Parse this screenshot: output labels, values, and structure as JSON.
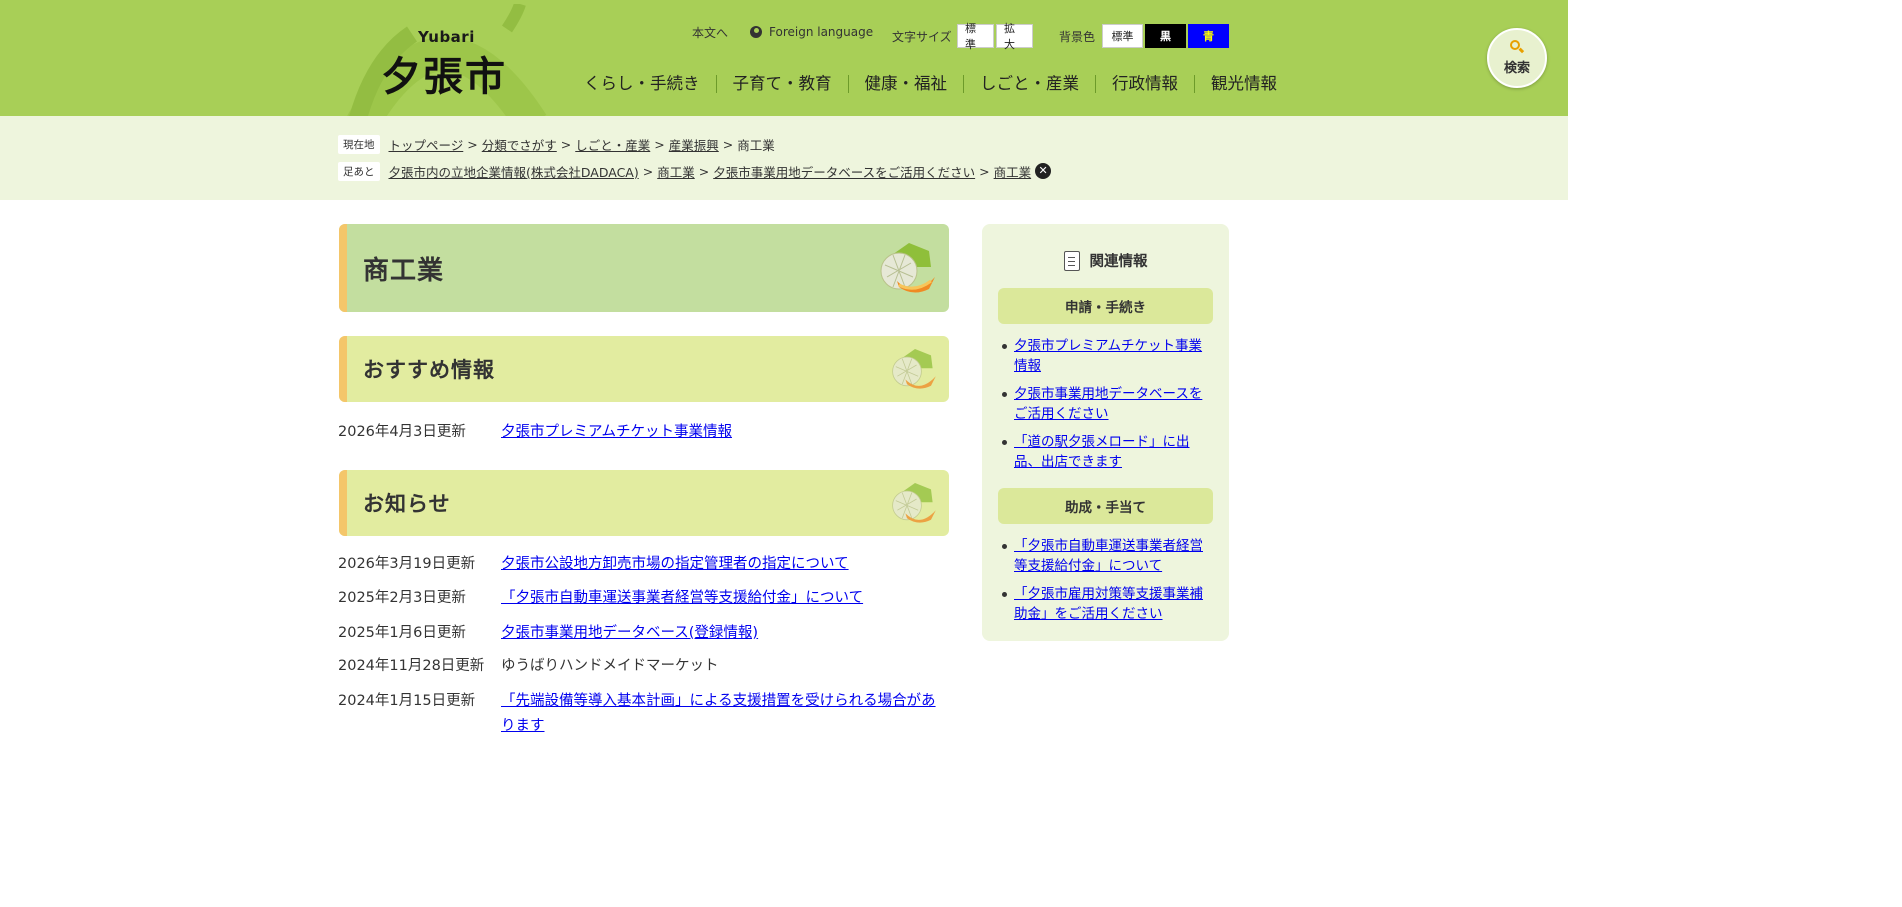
{
  "header": {
    "logo_en": "Yubari",
    "logo_jp": "夕張市",
    "honbun_link": "本文へ",
    "foreign_language": "Foreign language",
    "font_size_label": "文字サイズ",
    "font_size_standard": "標準",
    "font_size_large": "拡大",
    "bg_color_label": "背景色",
    "bg_standard": "標準",
    "bg_black": "黒",
    "bg_blue": "青",
    "nav": [
      "くらし・手続き",
      "子育て・教育",
      "健康・福祉",
      "しごと・産業",
      "行政情報",
      "観光情報"
    ],
    "search_label": "検索"
  },
  "breadcrumb": {
    "current_tag": "現在地",
    "current": [
      "トップページ",
      "分類でさがす",
      "しごと・産業",
      "産業振興"
    ],
    "current_page": "商工業",
    "history_tag": "足あと",
    "history": [
      "夕張市内の立地企業情報(株式会社DADACA)",
      "商工業",
      "夕張市事業用地データベースをご活用ください",
      "商工業"
    ],
    "separator": ">",
    "close_symbol": "✕"
  },
  "main": {
    "page_title": "商工業",
    "recommend_heading": "おすすめ情報",
    "recommend": [
      {
        "date": "2026年4月3日更新",
        "title": "夕張市プレミアムチケット事業情報",
        "link": true
      }
    ],
    "news_heading": "お知らせ",
    "news": [
      {
        "date": "2026年3月19日更新",
        "title": "夕張市公設地方卸売市場の指定管理者の指定について",
        "link": true
      },
      {
        "date": "2025年2月3日更新",
        "title": "「夕張市自動車運送事業者経営等支援給付金」について",
        "link": true
      },
      {
        "date": "2025年1月6日更新",
        "title": "夕張市事業用地データベース(登録情報)",
        "link": true
      },
      {
        "date": "2024年11月28日更新",
        "title": "ゆうばりハンドメイドマーケット",
        "link": false
      },
      {
        "date": "2024年1月15日更新",
        "title": "「先端設備等導入基本計画」による支援措置を受けられる場合があります",
        "link": true
      }
    ]
  },
  "sidebar": {
    "title": "関連情報",
    "categories": [
      {
        "label": "申請・手続き",
        "items": [
          "夕張市プレミアムチケット事業情報",
          "夕張市事業用地データベースをご活用ください",
          "「道の駅夕張メロード」に出品、出店できます"
        ]
      },
      {
        "label": "助成・手当て",
        "items": [
          "「夕張市自動車運送事業者経営等支援給付金」について",
          "「夕張市雇用対策等支援事業補助金」をご活用ください"
        ]
      }
    ]
  },
  "colors": {
    "header_green": "#a8cf57",
    "crumb_band": "#eef5dd",
    "title_box": "#c3de9f",
    "sub_box": "#e2eca0",
    "accent_orange": "#f4c66a",
    "link_blue": "#0000ee"
  }
}
